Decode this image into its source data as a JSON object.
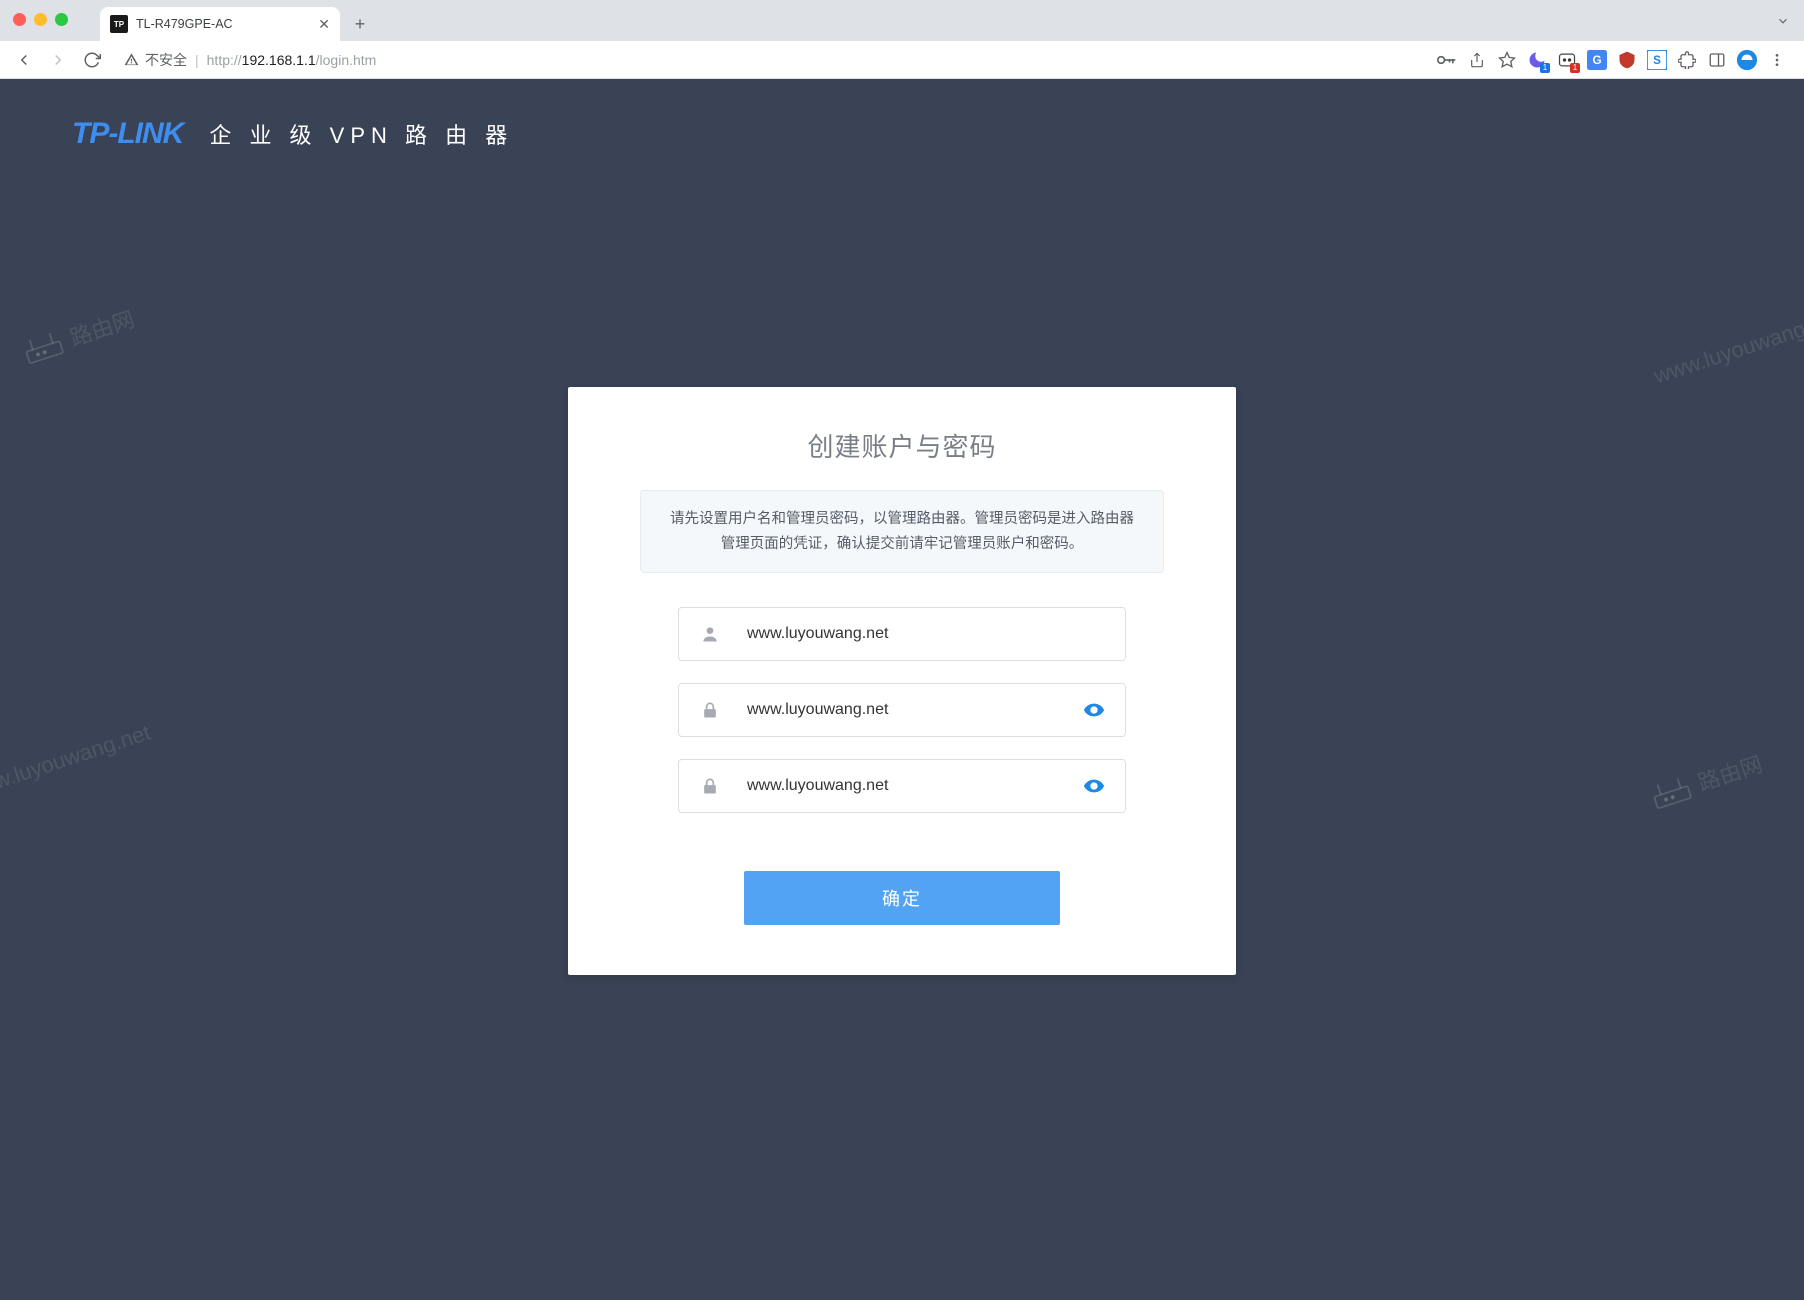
{
  "browser": {
    "tab_title": "TL-R479GPE-AC",
    "favicon_text": "TP",
    "insecure_label": "不安全",
    "url_prefix": "http://",
    "url_host": "192.168.1.1",
    "url_path": "/login.htm"
  },
  "header": {
    "brand": "TP-LINK",
    "subtitle": "企 业 级 VPN 路 由 器"
  },
  "card": {
    "title": "创建账户与密码",
    "info": "请先设置用户名和管理员密码，以管理路由器。管理员密码是进入路由器管理页面的凭证，确认提交前请牢记管理员账户和密码。",
    "submit_label": "确定"
  },
  "fields": {
    "username_value": "www.luyouwang.net",
    "password_value": "www.luyouwang.net",
    "confirm_value": "www.luyouwang.net"
  },
  "watermarks": {
    "text": "www.luyouwang.net",
    "router_label": "路由网"
  }
}
